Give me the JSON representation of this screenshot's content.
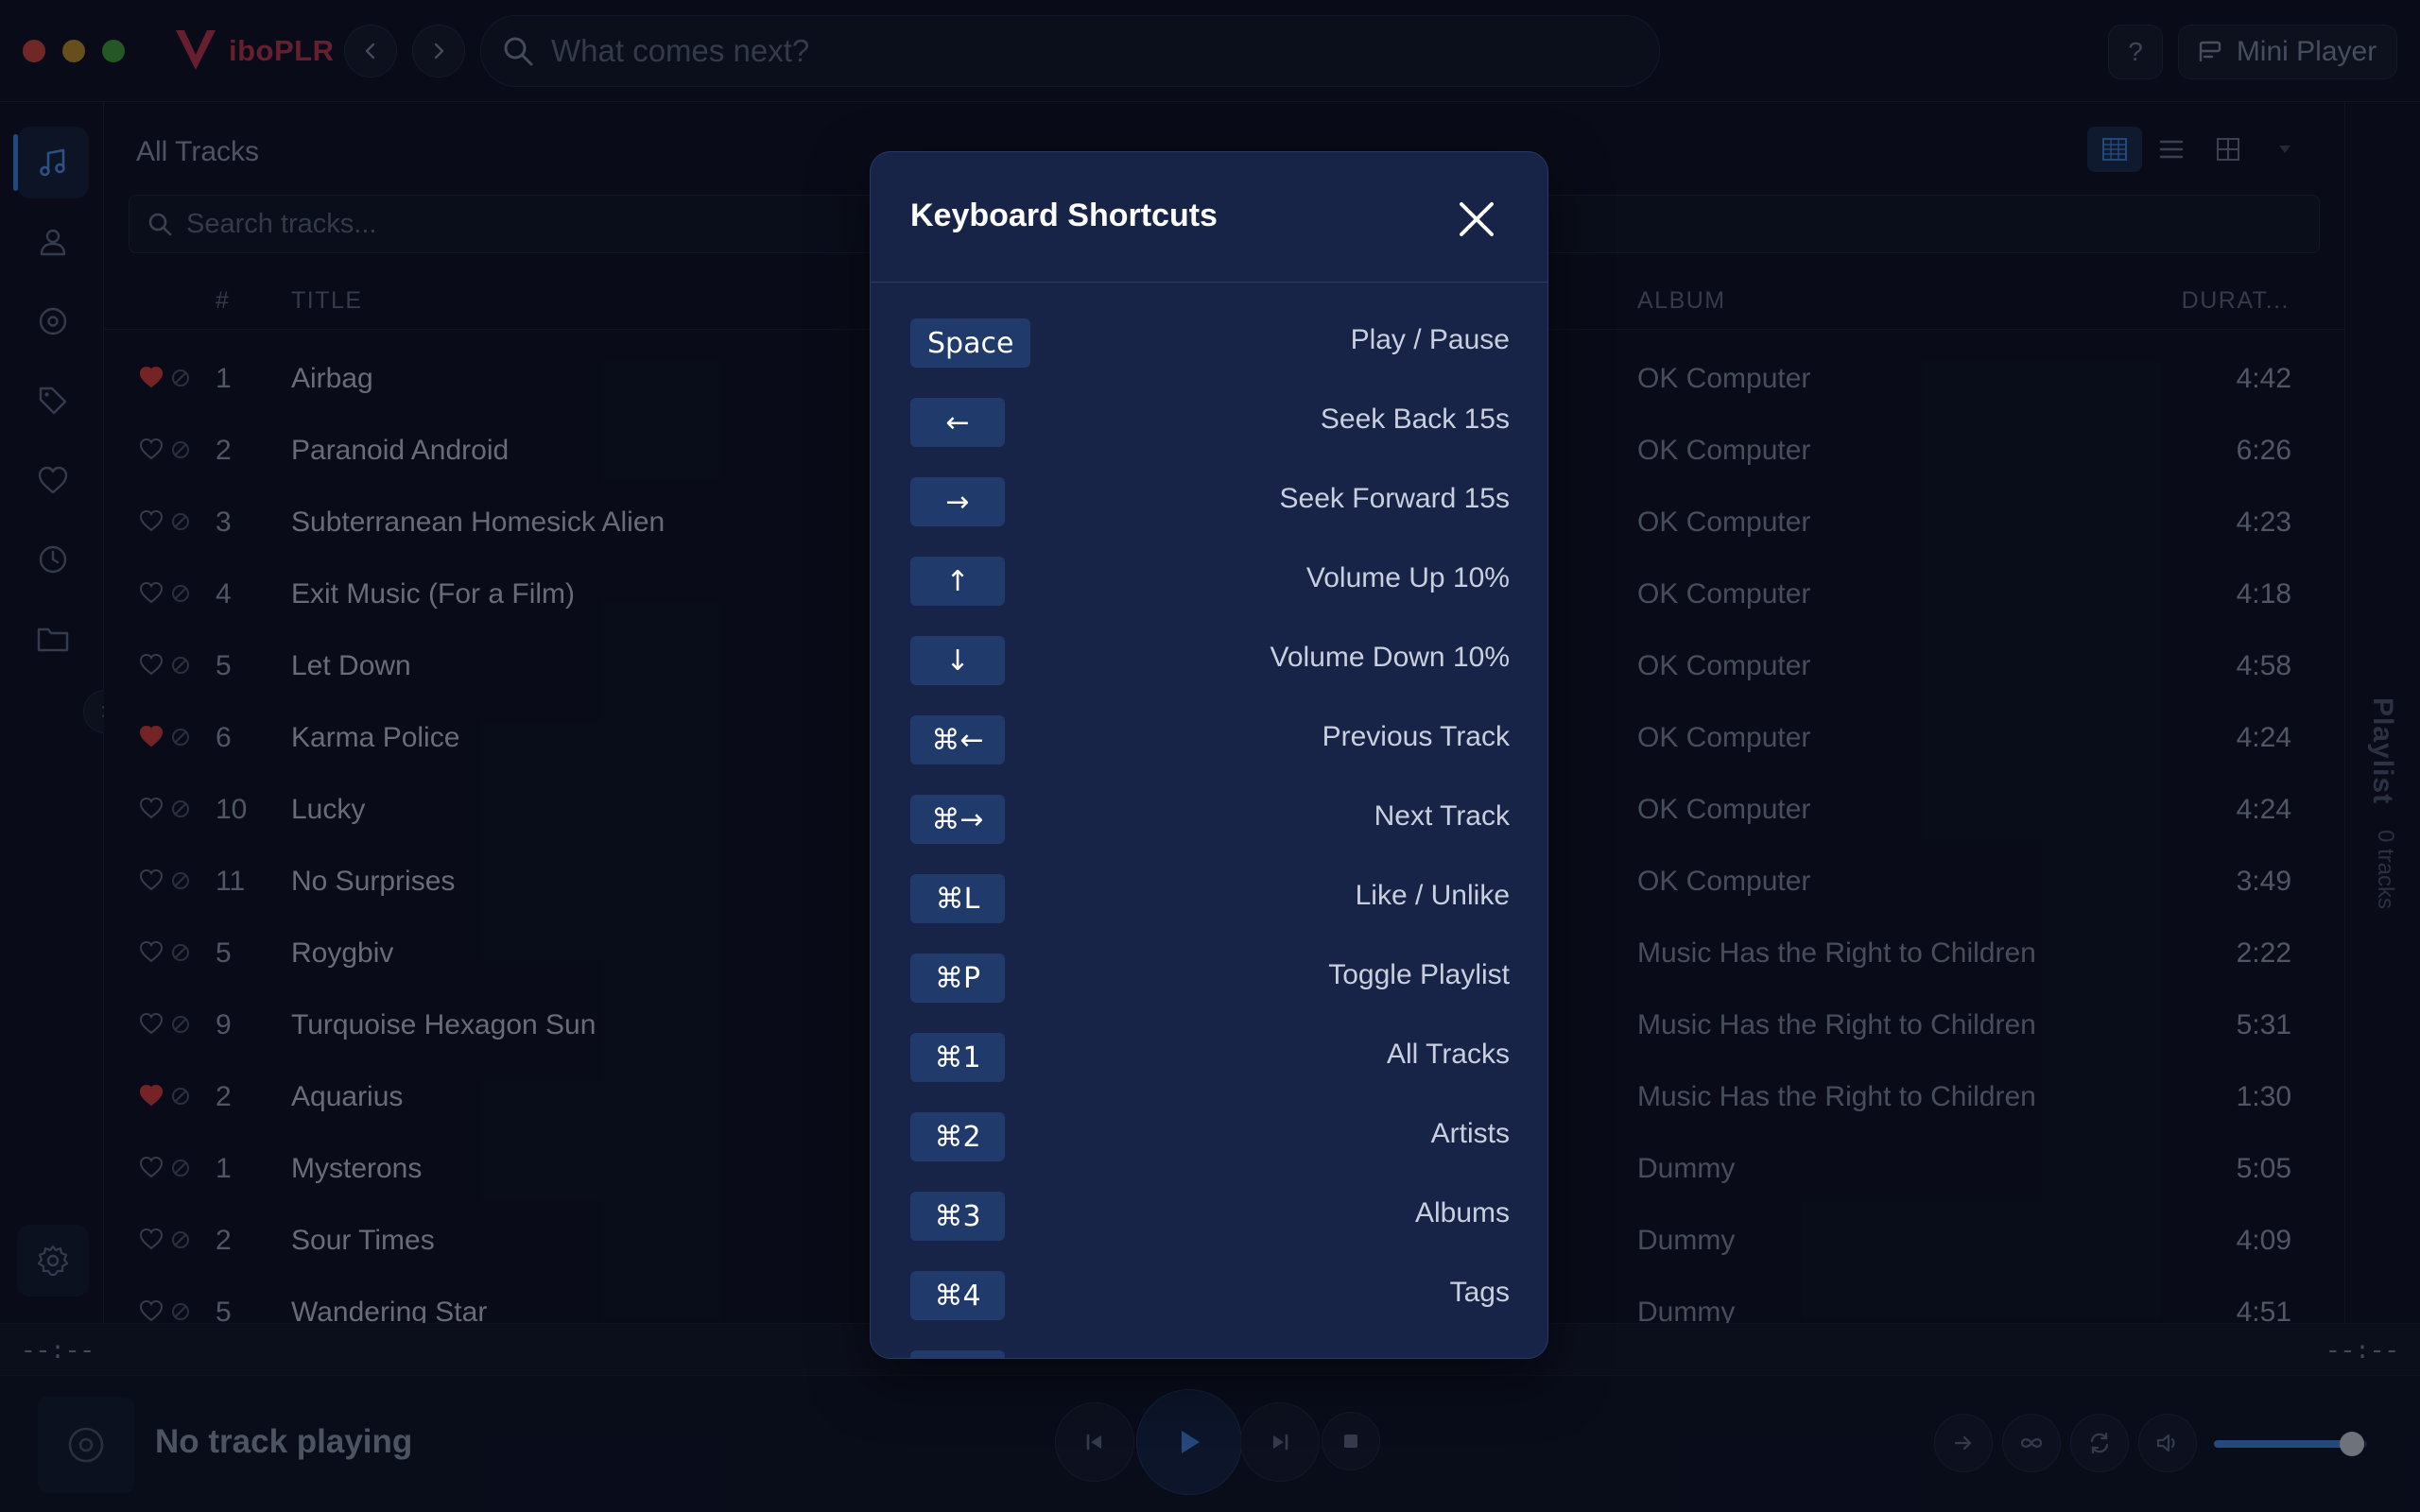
{
  "app": {
    "name": "iboPLR",
    "search_placeholder": "What comes next?",
    "help_label": "?",
    "mini_player_label": "Mini Player"
  },
  "sidebar": {
    "items": [
      {
        "icon": "music-note-icon",
        "active": true
      },
      {
        "icon": "person-icon",
        "active": false
      },
      {
        "icon": "disc-icon",
        "active": false
      },
      {
        "icon": "tag-icon",
        "active": false
      },
      {
        "icon": "heart-icon",
        "active": false
      },
      {
        "icon": "clock-icon",
        "active": false
      },
      {
        "icon": "folder-icon",
        "active": false
      }
    ],
    "settings_icon": "gear-icon"
  },
  "main": {
    "title": "All Tracks",
    "search_placeholder": "Search tracks...",
    "columns": {
      "number": "#",
      "title": "TITLE",
      "album": "ALBUM",
      "duration": "DURAT..."
    },
    "tracks": [
      {
        "liked": true,
        "number": "1",
        "title": "Airbag",
        "album": "OK Computer",
        "duration": "4:42"
      },
      {
        "liked": false,
        "number": "2",
        "title": "Paranoid Android",
        "album": "OK Computer",
        "duration": "6:26"
      },
      {
        "liked": false,
        "number": "3",
        "title": "Subterranean Homesick Alien",
        "album": "OK Computer",
        "duration": "4:23"
      },
      {
        "liked": false,
        "number": "4",
        "title": "Exit Music (For a Film)",
        "album": "OK Computer",
        "duration": "4:18"
      },
      {
        "liked": false,
        "number": "5",
        "title": "Let Down",
        "album": "OK Computer",
        "duration": "4:58"
      },
      {
        "liked": true,
        "number": "6",
        "title": "Karma Police",
        "album": "OK Computer",
        "duration": "4:24"
      },
      {
        "liked": false,
        "number": "10",
        "title": "Lucky",
        "album": "OK Computer",
        "duration": "4:24"
      },
      {
        "liked": false,
        "number": "11",
        "title": "No Surprises",
        "album": "OK Computer",
        "duration": "3:49"
      },
      {
        "liked": false,
        "number": "5",
        "title": "Roygbiv",
        "album": "Music Has the Right to Children",
        "duration": "2:22"
      },
      {
        "liked": false,
        "number": "9",
        "title": "Turquoise Hexagon Sun",
        "album": "Music Has the Right to Children",
        "duration": "5:31"
      },
      {
        "liked": true,
        "number": "2",
        "title": "Aquarius",
        "album": "Music Has the Right to Children",
        "duration": "1:30"
      },
      {
        "liked": false,
        "number": "1",
        "title": "Mysterons",
        "album": "Dummy",
        "duration": "5:05"
      },
      {
        "liked": false,
        "number": "2",
        "title": "Sour Times",
        "album": "Dummy",
        "duration": "4:09"
      },
      {
        "liked": false,
        "number": "5",
        "title": "Wandering Star",
        "album": "Dummy",
        "duration": "4:51"
      }
    ]
  },
  "playlist": {
    "label": "Playlist",
    "count": "0 tracks"
  },
  "player": {
    "elapsed": "--:--",
    "remaining": "--:--",
    "now_playing": "No track playing",
    "volume_level": 0.9
  },
  "modal": {
    "title": "Keyboard Shortcuts",
    "shortcuts": [
      {
        "key": "Space",
        "action": "Play / Pause"
      },
      {
        "key": "←",
        "action": "Seek Back 15s"
      },
      {
        "key": "→",
        "action": "Seek Forward 15s"
      },
      {
        "key": "↑",
        "action": "Volume Up 10%"
      },
      {
        "key": "↓",
        "action": "Volume Down 10%"
      },
      {
        "key": "⌘←",
        "action": "Previous Track"
      },
      {
        "key": "⌘→",
        "action": "Next Track"
      },
      {
        "key": "⌘L",
        "action": "Like / Unlike"
      },
      {
        "key": "⌘P",
        "action": "Toggle Playlist"
      },
      {
        "key": "⌘1",
        "action": "All Tracks"
      },
      {
        "key": "⌘2",
        "action": "Artists"
      },
      {
        "key": "⌘3",
        "action": "Albums"
      },
      {
        "key": "⌘4",
        "action": "Tags"
      }
    ]
  },
  "colors": {
    "accent": "#3f7fd8",
    "brand": "#b8324a",
    "liked_heart": "#d23b3b",
    "modal_bg": "#172448"
  }
}
